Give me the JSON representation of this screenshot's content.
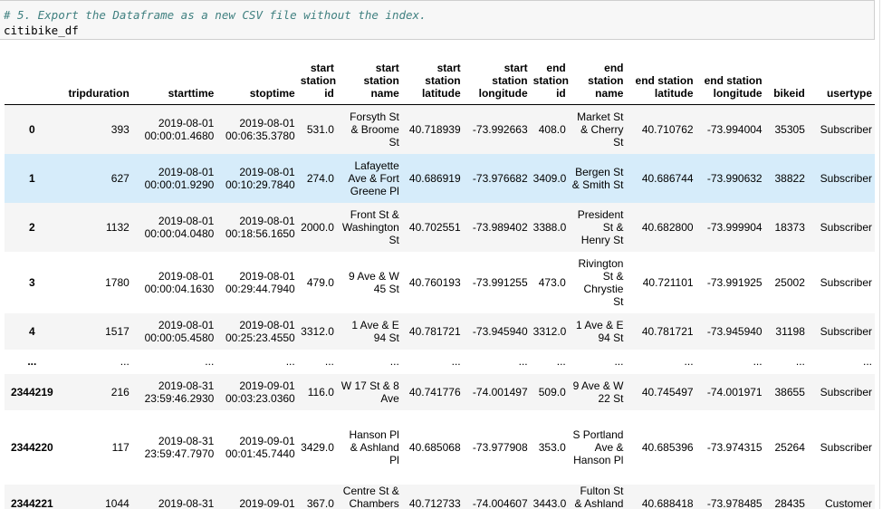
{
  "cell": {
    "comment": "# 5. Export the Dataframe as a new CSV file without the index.",
    "code": "citibike_df"
  },
  "table": {
    "columns": [
      {
        "id": "tripduration",
        "label": "tripduration"
      },
      {
        "id": "starttime",
        "label": "starttime"
      },
      {
        "id": "stoptime",
        "label": "stoptime"
      },
      {
        "id": "start_station_id",
        "label": "start station id"
      },
      {
        "id": "start_station_name",
        "label": "start station name"
      },
      {
        "id": "start_station_latitude",
        "label": "start station latitude"
      },
      {
        "id": "start_station_longitude",
        "label": "start station longitude"
      },
      {
        "id": "end_station_id",
        "label": "end station id"
      },
      {
        "id": "end_station_name",
        "label": "end station name"
      },
      {
        "id": "end_station_latitude",
        "label": "end station latitude"
      },
      {
        "id": "end_station_longitude",
        "label": "end station longitude"
      },
      {
        "id": "bikeid",
        "label": "bikeid"
      },
      {
        "id": "usertype",
        "label": "usertype"
      }
    ],
    "rows": [
      {
        "index": "0",
        "cells": [
          "393",
          "2019-08-01 00:00:01.4680",
          "2019-08-01 00:06:35.3780",
          "531.0",
          "Forsyth St & Broome St",
          "40.718939",
          "-73.992663",
          "408.0",
          "Market St & Cherry St",
          "40.710762",
          "-73.994004",
          "35305",
          "Subscriber"
        ]
      },
      {
        "index": "1",
        "cells": [
          "627",
          "2019-08-01 00:00:01.9290",
          "2019-08-01 00:10:29.7840",
          "274.0",
          "Lafayette Ave & Fort Greene Pl",
          "40.686919",
          "-73.976682",
          "3409.0",
          "Bergen St & Smith St",
          "40.686744",
          "-73.990632",
          "38822",
          "Subscriber"
        ],
        "hover": true
      },
      {
        "index": "2",
        "cells": [
          "1132",
          "2019-08-01 00:00:04.0480",
          "2019-08-01 00:18:56.1650",
          "2000.0",
          "Front St & Washington St",
          "40.702551",
          "-73.989402",
          "3388.0",
          "President St & Henry St",
          "40.682800",
          "-73.999904",
          "18373",
          "Subscriber"
        ]
      },
      {
        "index": "3",
        "cells": [
          "1780",
          "2019-08-01 00:00:04.1630",
          "2019-08-01 00:29:44.7940",
          "479.0",
          "9 Ave & W 45 St",
          "40.760193",
          "-73.991255",
          "473.0",
          "Rivington St & Chrystie St",
          "40.721101",
          "-73.991925",
          "25002",
          "Subscriber"
        ]
      },
      {
        "index": "4",
        "cells": [
          "1517",
          "2019-08-01 00:00:05.4580",
          "2019-08-01 00:25:23.4550",
          "3312.0",
          "1 Ave & E 94 St",
          "40.781721",
          "-73.945940",
          "3312.0",
          "1 Ave & E 94 St",
          "40.781721",
          "-73.945940",
          "31198",
          "Subscriber"
        ]
      },
      {
        "index": "...",
        "cells": [
          "...",
          "...",
          "...",
          "...",
          "...",
          "...",
          "...",
          "...",
          "...",
          "...",
          "...",
          "...",
          "..."
        ]
      },
      {
        "index": "2344219",
        "cells": [
          "216",
          "2019-08-31 23:59:46.2930",
          "2019-09-01 00:03:23.0360",
          "116.0",
          "W 17 St & 8 Ave",
          "40.741776",
          "-74.001497",
          "509.0",
          "9 Ave & W 22 St",
          "40.745497",
          "-74.001971",
          "38655",
          "Subscriber"
        ]
      },
      {
        "index": "2344220",
        "cells": [
          "117",
          "2019-08-31 23:59:47.7970",
          "2019-09-01 00:01:45.7440",
          "3429.0",
          "Hanson Pl & Ashland Pl",
          "40.685068",
          "-73.977908",
          "353.0",
          "S Portland Ave & Hanson Pl",
          "40.685396",
          "-73.974315",
          "25264",
          "Subscriber"
        ]
      },
      {
        "index": "2344221",
        "cells": [
          "1044",
          "2019-08-31",
          "2019-09-01",
          "367.0",
          "Centre St & Chambers St",
          "40.712733",
          "-74.004607",
          "3443.0",
          "Fulton St & Ashland Pl",
          "40.688418",
          "-73.978485",
          "28435",
          "Customer"
        ]
      }
    ]
  }
}
